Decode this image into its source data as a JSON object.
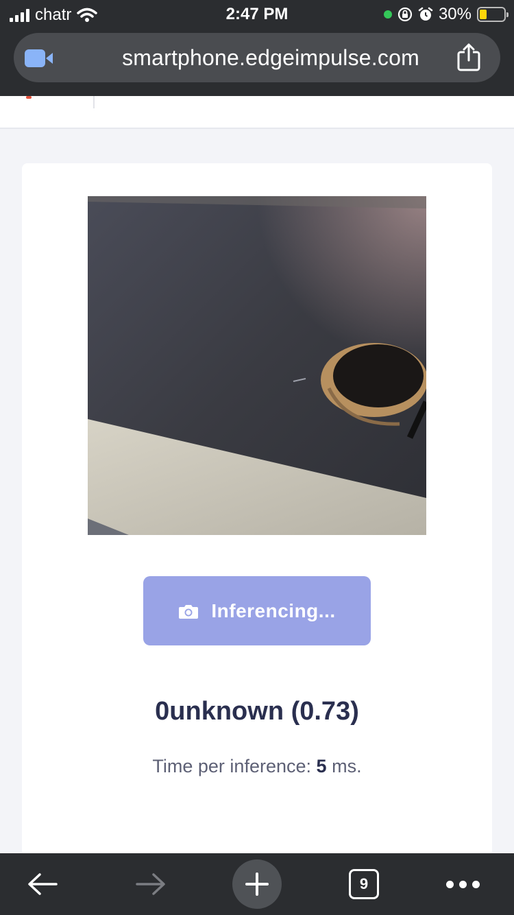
{
  "status_bar": {
    "carrier": "chatr",
    "time": "2:47 PM",
    "battery": "30%",
    "battery_level": 0.3,
    "icons": [
      "signal-icon",
      "wifi-icon",
      "camera-in-use-dot",
      "orientation-lock-icon",
      "alarm-icon",
      "battery-icon"
    ]
  },
  "browser": {
    "url": "smartphone.edgeimpulse.com",
    "site_icon": "zoom-video-icon",
    "share_icon": "share-icon"
  },
  "main": {
    "camera_feed": "camera-feed",
    "inference_button_label": "Inferencing...",
    "inference_button_icon": "camera-icon",
    "result": "0unknown (0.73)",
    "timing_prefix": "Time per inference:",
    "timing_value": "5",
    "timing_suffix": "ms."
  },
  "toolbar": {
    "back_icon": "back-arrow-icon",
    "forward_icon": "forward-arrow-icon",
    "new_tab_icon": "plus-icon",
    "tab_count": "9",
    "menu_icon": "more-dots-icon"
  },
  "colors": {
    "chrome_dark": "#2b2d30",
    "url_pill": "#4a4c50",
    "button_accent": "#99a3e6",
    "result_text": "#2a2f4f",
    "battery_yellow": "#ffd60a",
    "active_dot": "#34c759"
  }
}
